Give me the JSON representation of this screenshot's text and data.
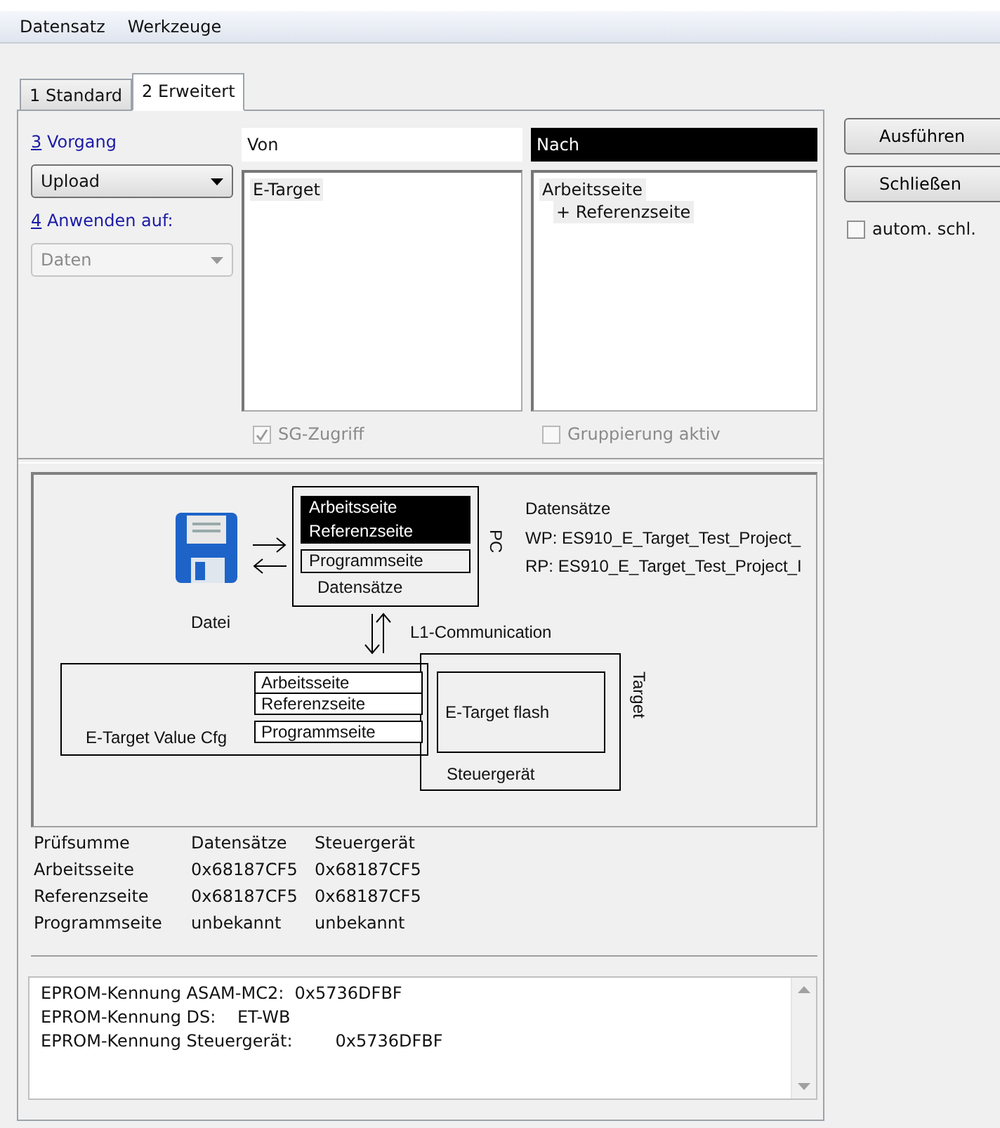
{
  "menu": [
    {
      "label": "Datensatz"
    },
    {
      "label": "Werkzeuge"
    }
  ],
  "tabs": [
    {
      "label": "1 Standard",
      "selected": false
    },
    {
      "label": "2 Erweitert",
      "selected": true
    }
  ],
  "operation": {
    "key": "3",
    "label": " Vorgang",
    "value": "Upload",
    "disabled": false
  },
  "apply_to": {
    "key": "4",
    "label": " Anwenden auf:",
    "value": "Daten",
    "disabled": true
  },
  "from": {
    "header": "Von",
    "selected": false,
    "items": [
      {
        "text": "E-Target"
      }
    ],
    "option": {
      "label": "SG-Zugriff",
      "checked": true,
      "disabled": true
    }
  },
  "to": {
    "header": "Nach",
    "selected": true,
    "items": [
      {
        "text": "Arbeitsseite",
        "children": [
          {
            "text": "+ Referenzseite"
          }
        ]
      }
    ],
    "option": {
      "label": "Gruppierung aktiv",
      "checked": false,
      "disabled": true
    }
  },
  "diagram": {
    "file_label": "Datei",
    "pc": {
      "label": "PC",
      "caption": "Datensätze",
      "pages": [
        {
          "text": "Arbeitsseite",
          "selected": true
        },
        {
          "text": "Referenzseite",
          "selected": true
        },
        {
          "text": "Programmseite",
          "selected": false
        }
      ]
    },
    "datasets": {
      "title": "Datensätze",
      "lines": [
        "WP: ES910_E_Target_Test_Project_",
        "RP: ES910_E_Target_Test_Project_I"
      ]
    },
    "link_label": "L1-Communication",
    "value_cfg": {
      "label": "E-Target Value Cfg",
      "pages": [
        "Arbeitsseite",
        "Referenzseite",
        "Programmseite"
      ]
    },
    "target": {
      "label": "Target",
      "caption": "Steuergerät",
      "flash": "E-Target flash"
    }
  },
  "checksums": {
    "columns": [
      "Prüfsumme",
      "Datensätze",
      "Steuergerät"
    ],
    "rows": [
      [
        "Arbeitsseite",
        "0x68187CF5",
        "0x68187CF5"
      ],
      [
        "Referenzseite",
        "0x68187CF5",
        "0x68187CF5"
      ],
      [
        "Programmseite",
        "unbekannt",
        "unbekannt"
      ]
    ]
  },
  "log": [
    "EPROM-Kennung ASAM-MC2:  0x5736DFBF",
    "EPROM-Kennung DS:    ET-WB",
    "EPROM-Kennung Steuergerät:        0x5736DFBF"
  ],
  "buttons": [
    {
      "label": "Ausführen"
    },
    {
      "label": "Schließen"
    }
  ],
  "auto_close": {
    "label": "autom. schl.",
    "checked": false
  }
}
